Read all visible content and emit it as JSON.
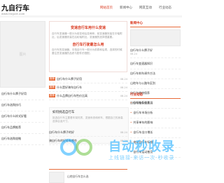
{
  "logo": {
    "title": "九自行车",
    "sub": "www.bicycle.com"
  },
  "nav": [
    "网站首页",
    "新闻中心",
    "网友互动",
    "行业动态"
  ],
  "nav_active": 0,
  "left_placeholder": "图片",
  "left_list": [
    "自行车什么牌子好用",
    "自行车选购技巧",
    "自行车什么样式好看",
    "自行车品牌推荐",
    "自行车选购攻略"
  ],
  "hot": {
    "title": "变速自行车用什么变速",
    "text": "自行车变速器一般分为前变和后变两种，前变速器安装在中轴附近，后变速器安装在后轮轴附近，变速器的选择很重要。",
    "sub": "自行车行驶最怎么用",
    "text2": "自行车的变速器，中档自行车一般分为前拨和后拨，选择的时候要注意变速器的品质与配件的搭配。"
  },
  "mid_list": [
    {
      "tag": "推荐",
      "text": "自行车什么牌子好用",
      "date": "08-24"
    },
    {
      "tag": "推荐",
      "text": "什么是好骑车自行车",
      "date": "08-24"
    },
    {
      "tag": "推荐",
      "text": "什么品牌自行车性价比高",
      "date": "08-24"
    }
  ],
  "mid_card2": {
    "title": "如何挑选自行车",
    "desc": "挑选自行车主要看车架材质、变速系统和刹车，根据自己的身高选择合适尺寸。"
  },
  "mid_list2": [
    {
      "text": "自行车什么牌子的好",
      "date": "08-24"
    },
    {
      "text": "骑自行车的好处有哪些",
      "date": "08-24"
    }
  ],
  "section_title": "网友互动",
  "bottom_text": "山地自行车怎么选",
  "right_head": "新闻中心",
  "right_feature": {
    "title": "自行车什么牌子好",
    "date": "08-24"
  },
  "right_list": [
    "自行车变速器知识",
    "自行车刹车调节方法",
    "山地车与公路车区别",
    "自行车维修保养",
    "自行车链条保养"
  ],
  "right_head2": "行业动态",
  "right_list2": [
    "自行车行业发展",
    "自行车市场分析",
    "共享单车的影响",
    "自行车出口增长",
    "电动自行车标准",
    "自行车运动普及"
  ],
  "watermark": {
    "title": "自动秒收录",
    "sub": "上线链接·来访一次·秒收录"
  }
}
